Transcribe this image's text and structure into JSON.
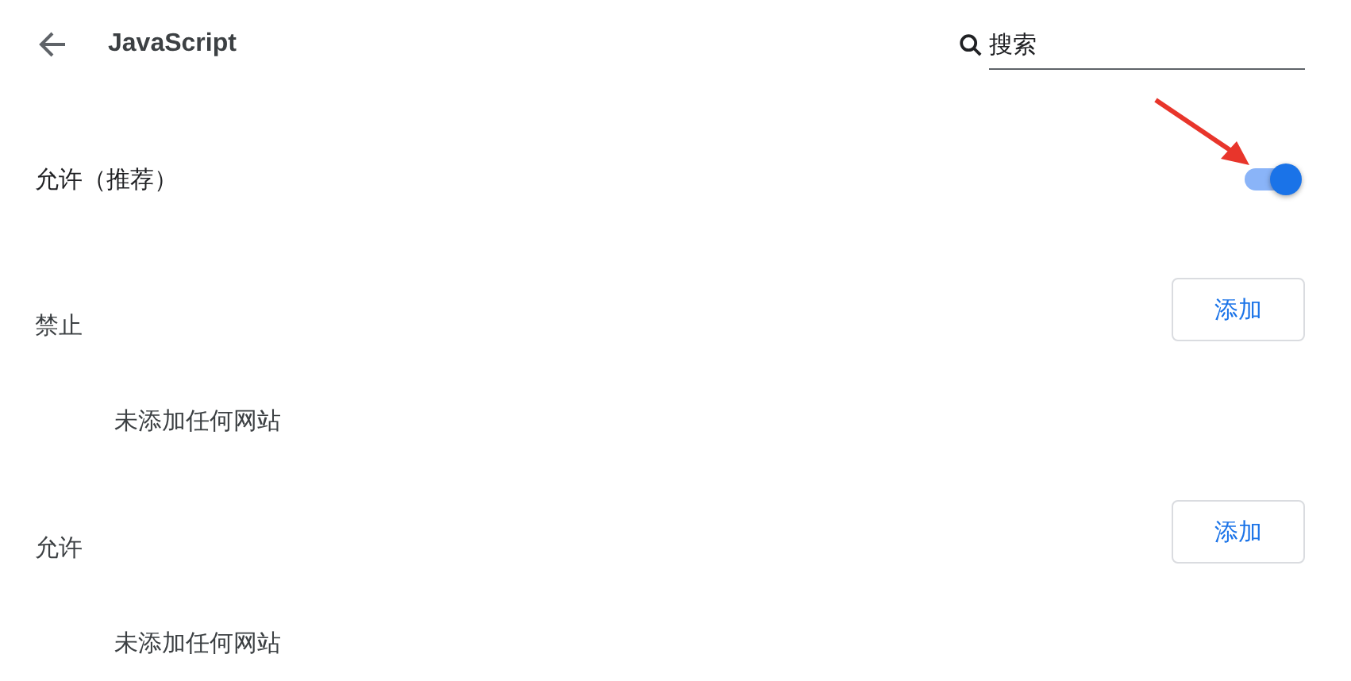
{
  "header": {
    "title": "JavaScript"
  },
  "search": {
    "placeholder": "搜索"
  },
  "default_setting": {
    "label": "允许（推荐）",
    "on": true
  },
  "sections": [
    {
      "heading": "禁止",
      "button": "添加",
      "empty_text": "未添加任何网站"
    },
    {
      "heading": "允许",
      "button": "添加",
      "empty_text": "未添加任何网站"
    }
  ]
}
